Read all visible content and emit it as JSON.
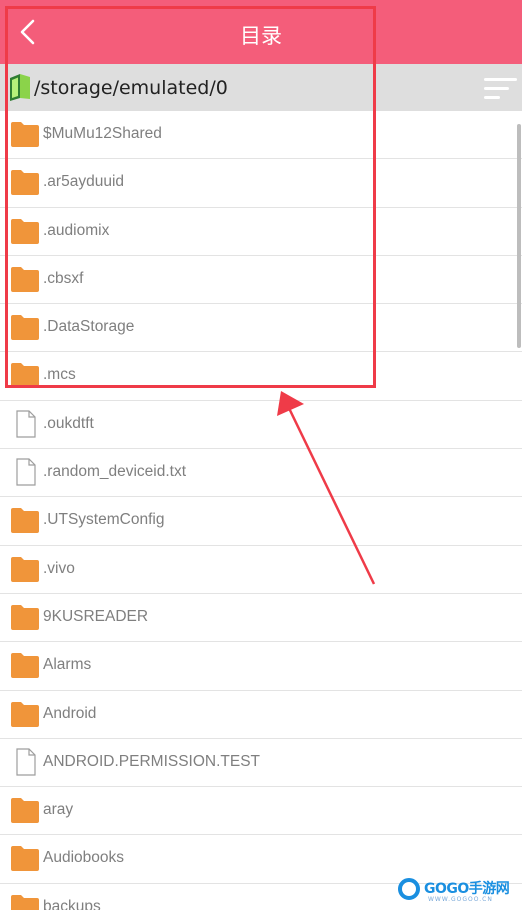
{
  "header": {
    "title": "目录",
    "back_icon": "chevron-left-icon",
    "background_color": "#f45d7a"
  },
  "pathbar": {
    "path": "/storage/emulated/0",
    "icon": "storage-icon",
    "sort_icon": "sort-icon"
  },
  "files": [
    {
      "name": "$MuMu12Shared",
      "type": "folder"
    },
    {
      "name": ".ar5ayduuid",
      "type": "folder"
    },
    {
      "name": ".audiomix",
      "type": "folder"
    },
    {
      "name": ".cbsxf",
      "type": "folder"
    },
    {
      "name": ".DataStorage",
      "type": "folder"
    },
    {
      "name": ".mcs",
      "type": "folder"
    },
    {
      "name": ".oukdtft",
      "type": "file"
    },
    {
      "name": ".random_deviceid.txt",
      "type": "file"
    },
    {
      "name": ".UTSystemConfig",
      "type": "folder"
    },
    {
      "name": ".vivo",
      "type": "folder"
    },
    {
      "name": "9KUSREADER",
      "type": "folder"
    },
    {
      "name": "Alarms",
      "type": "folder"
    },
    {
      "name": "Android",
      "type": "folder"
    },
    {
      "name": "ANDROID.PERMISSION.TEST",
      "type": "file"
    },
    {
      "name": "aray",
      "type": "folder"
    },
    {
      "name": "Audiobooks",
      "type": "folder"
    },
    {
      "name": "backups",
      "type": "folder"
    }
  ],
  "colors": {
    "folder": "#f0953a",
    "annotation": "#ef3b48",
    "watermark": "#1a8fe0"
  },
  "watermark": {
    "text": "GOGO手游网",
    "sub": "WWW.GOGOO.CN"
  }
}
